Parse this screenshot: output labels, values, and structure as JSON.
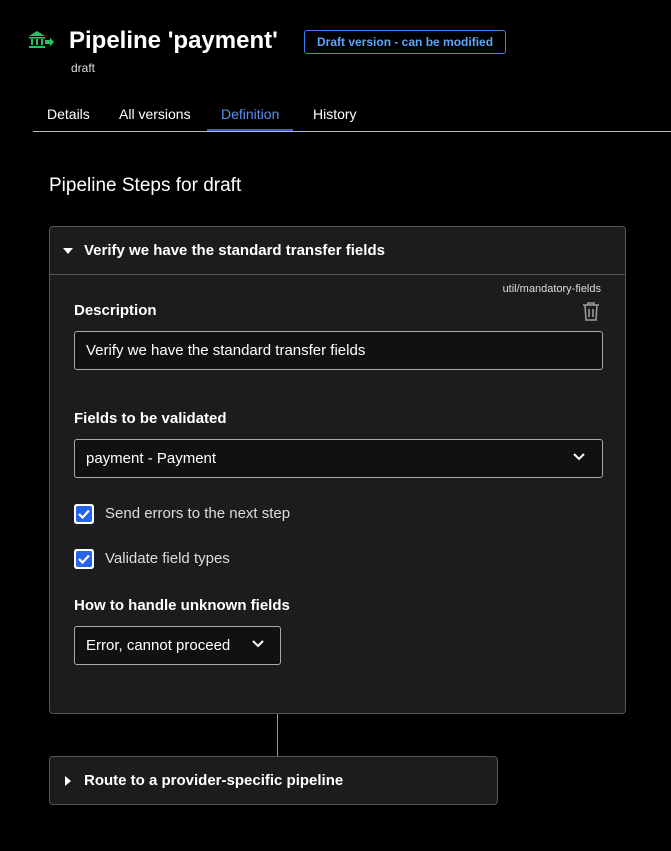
{
  "header": {
    "icon": "bank-transfer-icon",
    "title": "Pipeline 'payment'",
    "subtitle": "draft",
    "badge": "Draft version - can be modified",
    "accent": "#3b82f6",
    "icon_color": "#22c55e"
  },
  "tabs": [
    {
      "label": "Details",
      "active": false
    },
    {
      "label": "All versions",
      "active": false
    },
    {
      "label": "Definition",
      "active": true
    },
    {
      "label": "History",
      "active": false
    }
  ],
  "section_title": "Pipeline Steps for draft",
  "steps": [
    {
      "title": "Verify we have the standard transfer fields",
      "expanded": true,
      "type": "util/mandatory-fields",
      "description_label": "Description",
      "description_value": "Verify we have the standard transfer fields",
      "fields_label": "Fields to be validated",
      "fields_value": "payment - Payment",
      "checkboxes": [
        {
          "label": "Send errors to the next step",
          "checked": true
        },
        {
          "label": "Validate field types",
          "checked": true
        }
      ],
      "unknown_label": "How to handle unknown fields",
      "unknown_value": "Error, cannot proceed"
    },
    {
      "title": "Route to a provider-specific pipeline",
      "expanded": false
    }
  ]
}
